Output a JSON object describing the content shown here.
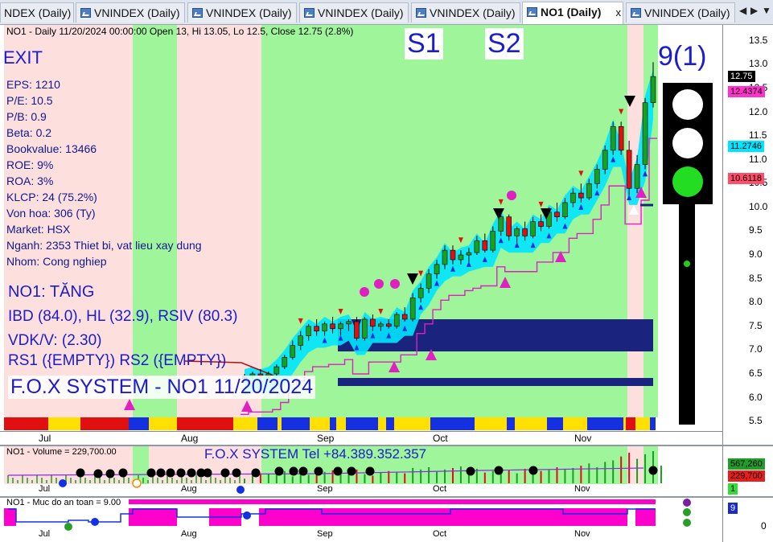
{
  "tabs": [
    {
      "label": "NDEX (Daily)",
      "active": false
    },
    {
      "label": "VNINDEX (Daily)",
      "active": false
    },
    {
      "label": "VNINDEX (Daily)",
      "active": false
    },
    {
      "label": "VNINDEX (Daily)",
      "active": false
    },
    {
      "label": "VNINDEX (Daily)",
      "active": false
    },
    {
      "label": "NO1 (Daily)",
      "active": true
    },
    {
      "label": "VNINDEX (Daily)",
      "active": false
    }
  ],
  "tab_close_glyph": "x",
  "tab_nav": {
    "left": "◀",
    "right": "▶",
    "menu": "▼"
  },
  "price_pane": {
    "header": "NO1 - Daily 11/20/2024 00:00:00 Open 13, Hi 13.05, Lo 12.5, Close 12.75 (2.8%)",
    "exit_label": "EXIT",
    "fundamentals": [
      "EPS: 1210",
      "P/E: 10.5",
      "P/B: 0.9",
      "Beta: 0.2",
      "Bookvalue: 13466",
      "ROE: 9%",
      "ROA: 3%",
      "KLCP: 24 (75.2%)",
      "Von hoa: 306 (Ty)",
      "Market: HSX",
      "Nganh: 2353 Thiet bi, vat lieu xay dung",
      "Nhom: Cong nghiep"
    ],
    "signal_title": "NO1: TĂNG",
    "ratings": "IBD (84.0), HL (32.9), RSIV (80.3)",
    "vdk": "VDK/V:  (2.30)",
    "rs_line": "RS1 ({EMPTY}) RS2 ({EMPTY})",
    "watermark": "F.O.X SYSTEM - NO1 11/20/2024",
    "s1_label": "S1",
    "s2_label": "S2",
    "score_label": "9(1)",
    "traffic_light": {
      "top": "#ffffff",
      "middle": "#ffffff",
      "bottom": "#22dd22"
    },
    "y_ticks": [
      "13.5",
      "13.0",
      "12.5",
      "12.0",
      "11.5",
      "11.0",
      "10.5",
      "10.0",
      "9.5",
      "9.0",
      "8.5",
      "8.0",
      "7.5",
      "7.0",
      "6.5",
      "6.0",
      "5.5"
    ],
    "price_tags": [
      {
        "text": "12.75",
        "bg": "#000000",
        "fg": "#ffffff"
      },
      {
        "text": "12.4374",
        "bg": "#ff33cc",
        "fg": "#000000"
      },
      {
        "text": "11.2746",
        "bg": "#00e5ff",
        "fg": "#000000"
      },
      {
        "text": "10.6118",
        "bg": "#ff4d6a",
        "fg": "#000000"
      }
    ],
    "months": [
      "Jul",
      "Aug",
      "Sep",
      "Oct",
      "Nov"
    ]
  },
  "volume_pane": {
    "header": "NO1 - Volume = 229,700.00",
    "title": "F.O.X SYSTEM Tel +84.389.352.357",
    "tags": [
      {
        "text": "567,260",
        "bg": "#1f9e2a",
        "fg": "#000000"
      },
      {
        "text": "229,700",
        "bg": "#e81e1e",
        "fg": "#000000"
      },
      {
        "text": "1",
        "bg": "#33dd33",
        "fg": "#000000"
      }
    ],
    "months": [
      "Jul",
      "Aug",
      "Sep",
      "Oct",
      "Nov"
    ]
  },
  "safety_pane": {
    "header": "NO1 - Muc do an toan = 9.00",
    "tag": "9",
    "y_tick": "0",
    "months": [
      "Jul",
      "Aug",
      "Sep",
      "Oct",
      "Nov"
    ]
  },
  "colors": {
    "green_zone": "#9ef59a",
    "pink_zone": "#fde0de",
    "navy": "#1a237e",
    "cyan": "#00e5ff",
    "magenta": "#e020c0"
  },
  "chart_data": {
    "type": "candlestick",
    "ticker": "NO1",
    "ylim": [
      5.3,
      13.8
    ],
    "candles": [
      {
        "o": 6.4,
        "h": 6.5,
        "l": 6.35,
        "c": 6.45
      },
      {
        "o": 6.45,
        "h": 6.55,
        "l": 6.4,
        "c": 6.5
      },
      {
        "o": 6.5,
        "h": 6.6,
        "l": 6.4,
        "c": 6.45
      },
      {
        "o": 6.45,
        "h": 6.55,
        "l": 6.4,
        "c": 6.5
      },
      {
        "o": 6.5,
        "h": 6.7,
        "l": 6.45,
        "c": 6.65
      },
      {
        "o": 6.65,
        "h": 6.9,
        "l": 6.6,
        "c": 6.85
      },
      {
        "o": 6.85,
        "h": 7.2,
        "l": 6.8,
        "c": 7.1
      },
      {
        "o": 7.1,
        "h": 7.4,
        "l": 7.0,
        "c": 7.3
      },
      {
        "o": 7.3,
        "h": 7.55,
        "l": 7.2,
        "c": 7.5
      },
      {
        "o": 7.5,
        "h": 7.65,
        "l": 7.3,
        "c": 7.4
      },
      {
        "o": 7.4,
        "h": 7.6,
        "l": 7.3,
        "c": 7.55
      },
      {
        "o": 7.55,
        "h": 7.7,
        "l": 7.35,
        "c": 7.45
      },
      {
        "o": 7.45,
        "h": 7.6,
        "l": 7.3,
        "c": 7.55
      },
      {
        "o": 7.55,
        "h": 7.65,
        "l": 7.4,
        "c": 7.6
      },
      {
        "o": 7.6,
        "h": 7.7,
        "l": 7.2,
        "c": 7.25
      },
      {
        "o": 7.25,
        "h": 7.7,
        "l": 7.2,
        "c": 7.65
      },
      {
        "o": 7.65,
        "h": 7.75,
        "l": 7.4,
        "c": 7.5
      },
      {
        "o": 7.5,
        "h": 7.6,
        "l": 7.4,
        "c": 7.55
      },
      {
        "o": 7.55,
        "h": 7.65,
        "l": 7.45,
        "c": 7.5
      },
      {
        "o": 7.5,
        "h": 7.8,
        "l": 7.45,
        "c": 7.75
      },
      {
        "o": 7.75,
        "h": 7.9,
        "l": 7.6,
        "c": 7.65
      },
      {
        "o": 7.65,
        "h": 8.2,
        "l": 7.6,
        "c": 8.1
      },
      {
        "o": 8.1,
        "h": 8.4,
        "l": 8.0,
        "c": 8.3
      },
      {
        "o": 8.3,
        "h": 8.7,
        "l": 8.2,
        "c": 8.6
      },
      {
        "o": 8.6,
        "h": 8.9,
        "l": 8.5,
        "c": 8.8
      },
      {
        "o": 8.8,
        "h": 9.2,
        "l": 8.7,
        "c": 9.1
      },
      {
        "o": 9.1,
        "h": 9.2,
        "l": 8.8,
        "c": 8.9
      },
      {
        "o": 8.9,
        "h": 9.1,
        "l": 8.8,
        "c": 9.0
      },
      {
        "o": 9.0,
        "h": 9.15,
        "l": 8.85,
        "c": 9.05
      },
      {
        "o": 9.05,
        "h": 9.4,
        "l": 9.0,
        "c": 9.3
      },
      {
        "o": 9.3,
        "h": 9.45,
        "l": 9.05,
        "c": 9.1
      },
      {
        "o": 9.1,
        "h": 9.6,
        "l": 9.05,
        "c": 9.5
      },
      {
        "o": 9.5,
        "h": 9.9,
        "l": 9.4,
        "c": 9.8
      },
      {
        "o": 9.8,
        "h": 9.85,
        "l": 9.3,
        "c": 9.4
      },
      {
        "o": 9.4,
        "h": 9.6,
        "l": 9.2,
        "c": 9.55
      },
      {
        "o": 9.55,
        "h": 9.7,
        "l": 9.3,
        "c": 9.4
      },
      {
        "o": 9.4,
        "h": 9.8,
        "l": 9.35,
        "c": 9.7
      },
      {
        "o": 9.7,
        "h": 9.85,
        "l": 9.5,
        "c": 9.6
      },
      {
        "o": 9.6,
        "h": 10.0,
        "l": 9.55,
        "c": 9.9
      },
      {
        "o": 9.9,
        "h": 10.1,
        "l": 9.7,
        "c": 9.8
      },
      {
        "o": 9.8,
        "h": 10.2,
        "l": 9.75,
        "c": 10.1
      },
      {
        "o": 10.1,
        "h": 10.4,
        "l": 10.0,
        "c": 10.3
      },
      {
        "o": 10.3,
        "h": 10.5,
        "l": 10.1,
        "c": 10.2
      },
      {
        "o": 10.2,
        "h": 10.6,
        "l": 10.15,
        "c": 10.5
      },
      {
        "o": 10.5,
        "h": 10.9,
        "l": 10.4,
        "c": 10.8
      },
      {
        "o": 10.8,
        "h": 11.3,
        "l": 10.7,
        "c": 11.2
      },
      {
        "o": 11.2,
        "h": 11.8,
        "l": 11.1,
        "c": 11.7
      },
      {
        "o": 11.7,
        "h": 11.8,
        "l": 11.1,
        "c": 11.2
      },
      {
        "o": 11.2,
        "h": 11.4,
        "l": 10.2,
        "c": 10.4
      },
      {
        "o": 10.4,
        "h": 11.1,
        "l": 10.3,
        "c": 10.9
      },
      {
        "o": 10.9,
        "h": 12.3,
        "l": 10.8,
        "c": 12.2
      },
      {
        "o": 12.2,
        "h": 13.05,
        "l": 12.1,
        "c": 12.75
      }
    ],
    "volume": [
      60,
      150,
      130,
      120,
      140,
      160,
      90,
      150,
      110,
      140,
      150,
      170,
      130,
      160,
      180,
      120,
      100,
      140,
      160,
      150,
      130,
      200,
      180,
      210,
      150,
      180,
      200,
      220,
      160,
      190,
      140,
      160,
      150,
      170,
      130,
      190,
      210,
      160,
      180,
      210,
      190,
      200,
      230,
      260,
      210,
      280,
      300,
      350,
      400,
      320,
      380,
      420,
      230
    ]
  }
}
